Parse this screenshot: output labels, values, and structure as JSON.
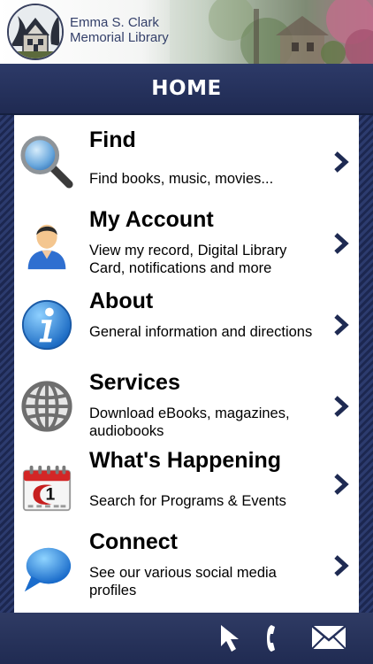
{
  "header": {
    "library_name_line1": "Emma S. Clark",
    "library_name_line2": "Memorial Library"
  },
  "title_bar": {
    "title": "HOME"
  },
  "menu": {
    "items": [
      {
        "title": "Find",
        "description": "Find books, music, movies...",
        "icon": "magnifier-icon"
      },
      {
        "title": "My Account",
        "description": "View my record, Digital Library Card, notifications and more",
        "icon": "user-icon"
      },
      {
        "title": "About",
        "description": "General information and directions",
        "icon": "info-icon"
      },
      {
        "title": "Services",
        "description": "Download eBooks, magazines, audiobooks",
        "icon": "globe-icon"
      },
      {
        "title": "What's Happening",
        "description": "Search for Programs & Events",
        "icon": "calendar-icon"
      },
      {
        "title": "Connect",
        "description": "See our various social media profiles",
        "icon": "speech-bubble-icon"
      }
    ]
  },
  "bottom_bar": {
    "icons": [
      "cursor-icon",
      "phone-icon",
      "mail-icon"
    ]
  },
  "colors": {
    "navy": "#24305a",
    "text_dark": "#000000",
    "logo_text": "#34406a"
  }
}
